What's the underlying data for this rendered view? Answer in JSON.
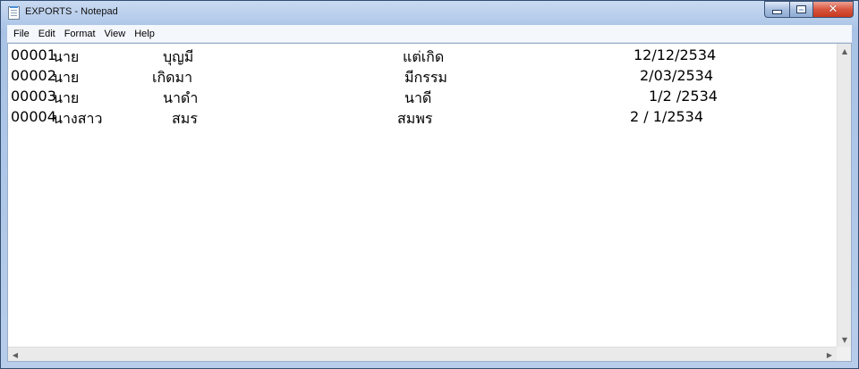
{
  "window": {
    "title": "EXPORTS - Notepad",
    "close_glyph": "✕"
  },
  "menu": [
    "File",
    "Edit",
    "Format",
    "View",
    "Help"
  ],
  "lines": [
    {
      "id": "00001",
      "title": "นาย",
      "first": "บุญมี",
      "last": "แต่เกิด",
      "date": "12/12/2534"
    },
    {
      "id": "00002",
      "title": "นาย",
      "first": "เกิดมา",
      "last": "มีกรรม",
      "date": "2/03/2534"
    },
    {
      "id": "00003",
      "title": "นาย",
      "first": "นาดำ",
      "last": "นาดี",
      "date": "1/2 /2534"
    },
    {
      "id": "00004",
      "title": "นางสาว",
      "first": "สมร",
      "last": "สมพร",
      "date": "2 / 1/2534"
    }
  ],
  "scroll": {
    "up": "▲",
    "down": "▼",
    "left": "◀",
    "right": "▶"
  },
  "icons": [
    "notepad-icon",
    "minimize-icon",
    "maximize-icon",
    "close-icon"
  ],
  "colors": {
    "close_button": "#c63a1f",
    "frame": "#a9c3e6"
  }
}
